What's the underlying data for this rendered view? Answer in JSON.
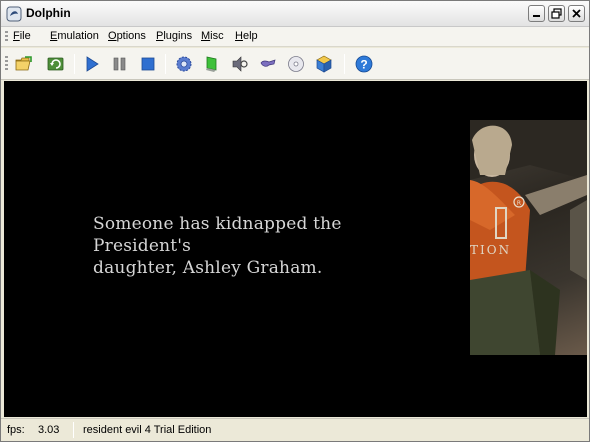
{
  "window": {
    "title": "Dolphin"
  },
  "menu": {
    "items": [
      {
        "label": "File",
        "access_key": "F",
        "rest": "ile"
      },
      {
        "label": "Emulation",
        "access_key": "E",
        "rest": "mulation"
      },
      {
        "label": "Options",
        "access_key": "O",
        "rest": "ptions"
      },
      {
        "label": "Plugins",
        "access_key": "P",
        "rest": "lugins"
      },
      {
        "label": "Misc",
        "access_key": "M",
        "rest": "isc"
      },
      {
        "label": "Help",
        "access_key": "H",
        "rest": "elp"
      }
    ]
  },
  "toolbar": {
    "buttons": [
      {
        "name": "open",
        "icon": "folder-open-icon"
      },
      {
        "name": "refresh",
        "icon": "refresh-icon"
      },
      {
        "name": "play",
        "icon": "play-icon"
      },
      {
        "name": "pause",
        "icon": "pause-icon"
      },
      {
        "name": "stop",
        "icon": "stop-icon"
      },
      {
        "name": "config",
        "icon": "gear-icon"
      },
      {
        "name": "graphics",
        "icon": "monitor-icon"
      },
      {
        "name": "audio",
        "icon": "speaker-icon"
      },
      {
        "name": "pad",
        "icon": "gamepad-icon"
      },
      {
        "name": "wiimote",
        "icon": "disc-icon"
      },
      {
        "name": "plugins",
        "icon": "cube-icon"
      },
      {
        "name": "help",
        "icon": "help-icon"
      }
    ]
  },
  "render": {
    "subtitle_line1": "Someone has kidnapped the President's",
    "subtitle_line2": "daughter, Ashley Graham.",
    "logo_text": "TION"
  },
  "status": {
    "fps_label": "fps:",
    "fps_value": "3.03",
    "game_title": "resident evil 4 Trial Edition"
  },
  "colors": {
    "render_bg": "#000000",
    "subtitle": "#d6d6d6",
    "chrome": "#ece9d8"
  }
}
